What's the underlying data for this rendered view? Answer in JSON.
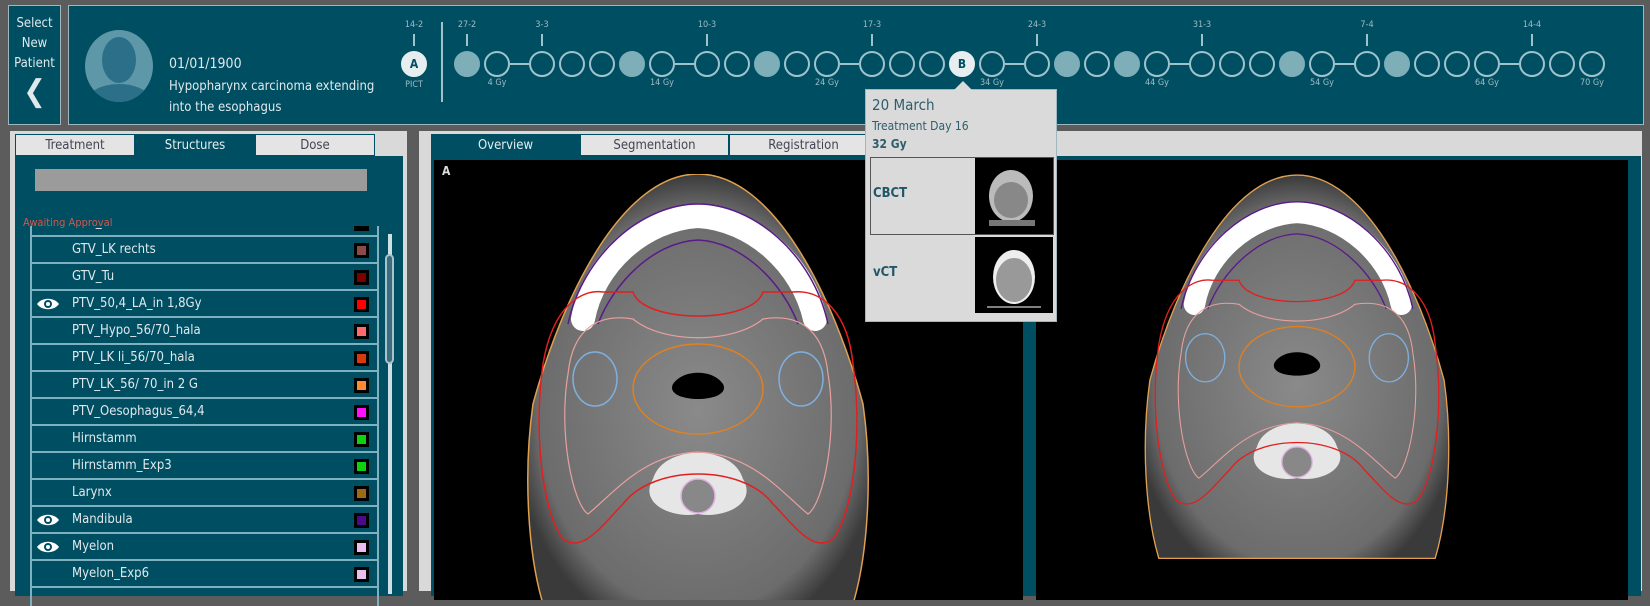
{
  "select_patient": {
    "lines": [
      "Select",
      "New",
      "Patient"
    ],
    "back_icon": "chevron-left-icon"
  },
  "patient": {
    "birthdate": "01/01/1900",
    "diagnosis": "Hypopharynx carcinoma extending into the esophagus",
    "avatar_icon": "user-silhouette-icon"
  },
  "timeline": {
    "plan_marker": {
      "label": "A",
      "date": "14-2",
      "sub": "PICT"
    },
    "fractions": [
      {
        "s": "filled",
        "date": "27-2"
      },
      {
        "s": "open",
        "gy": "4 Gy"
      },
      {
        "s": "open",
        "date": "3-3"
      },
      {
        "s": "open"
      },
      {
        "s": "open"
      },
      {
        "s": "filled"
      },
      {
        "s": "open",
        "gy": "14 Gy"
      },
      {
        "s": "open",
        "date": "10-3"
      },
      {
        "s": "open"
      },
      {
        "s": "filled"
      },
      {
        "s": "open"
      },
      {
        "s": "open",
        "gy": "24 Gy"
      },
      {
        "s": "open",
        "date": "17-3"
      },
      {
        "s": "open"
      },
      {
        "s": "open"
      },
      {
        "s": "marker",
        "label": "B"
      },
      {
        "s": "open",
        "gy": "34 Gy"
      },
      {
        "s": "open",
        "date": "24-3"
      },
      {
        "s": "filled"
      },
      {
        "s": "open"
      },
      {
        "s": "filled"
      },
      {
        "s": "open",
        "gy": "44 Gy"
      },
      {
        "s": "open",
        "date": "31-3"
      },
      {
        "s": "open"
      },
      {
        "s": "open"
      },
      {
        "s": "filled"
      },
      {
        "s": "open",
        "gy": "54 Gy"
      },
      {
        "s": "open",
        "date": "7-4"
      },
      {
        "s": "filled"
      },
      {
        "s": "open"
      },
      {
        "s": "open"
      },
      {
        "s": "open",
        "gy": "64 Gy"
      },
      {
        "s": "open",
        "date": "14-4"
      },
      {
        "s": "open"
      },
      {
        "s": "open",
        "gy": "70 Gy"
      }
    ],
    "week_breaks_after": [
      1,
      6,
      11,
      16,
      21,
      26,
      31
    ]
  },
  "left_panel": {
    "tabs": [
      "Treatment",
      "Structures",
      "Dose"
    ],
    "active_tab": "Structures",
    "search_value": "",
    "section": "Awaiting Approval",
    "structures": [
      {
        "name": "GTV_LK li",
        "color": "#000000",
        "visible": false
      },
      {
        "name": "GTV_LK rechts",
        "color": "#8b4a4a",
        "visible": false
      },
      {
        "name": "GTV_Tu",
        "color": "#7a0000",
        "visible": false
      },
      {
        "name": "PTV_50,4_LA_in 1,8Gy",
        "color": "#ff0000",
        "visible": true
      },
      {
        "name": "PTV_Hypo_56/70_hala",
        "color": "#ff6a6a",
        "visible": false
      },
      {
        "name": "PTV_LK li_56/70_hala",
        "color": "#d83a10",
        "visible": false
      },
      {
        "name": "PTV_LK_56/ 70_in 2 G",
        "color": "#ff8a30",
        "visible": false
      },
      {
        "name": "PTV_Oesophagus_64,4",
        "color": "#ff10ff",
        "visible": false
      },
      {
        "name": "Hirnstamm",
        "color": "#10d010",
        "visible": false
      },
      {
        "name": "Hirnstamm_Exp3",
        "color": "#10d010",
        "visible": false
      },
      {
        "name": "Larynx",
        "color": "#a06a10",
        "visible": false
      },
      {
        "name": "Mandibula",
        "color": "#4a0a8a",
        "visible": true
      },
      {
        "name": "Myelon",
        "color": "#e8c0f0",
        "visible": true
      },
      {
        "name": "Myelon_Exp6",
        "color": "#e8c0f0",
        "visible": false
      }
    ]
  },
  "viewer": {
    "tabs": [
      "Overview",
      "Segmentation",
      "Registration"
    ],
    "active_tab": "Overview",
    "left_label": "A"
  },
  "tooltip": {
    "date": "20 March",
    "day": "Treatment Day 16",
    "dose": "32 Gy",
    "images": [
      "CBCT",
      "vCT"
    ]
  },
  "colors": {
    "panel": "#004e62",
    "accent_light": "#9fc3cc",
    "awaiting": "#d0574b"
  }
}
